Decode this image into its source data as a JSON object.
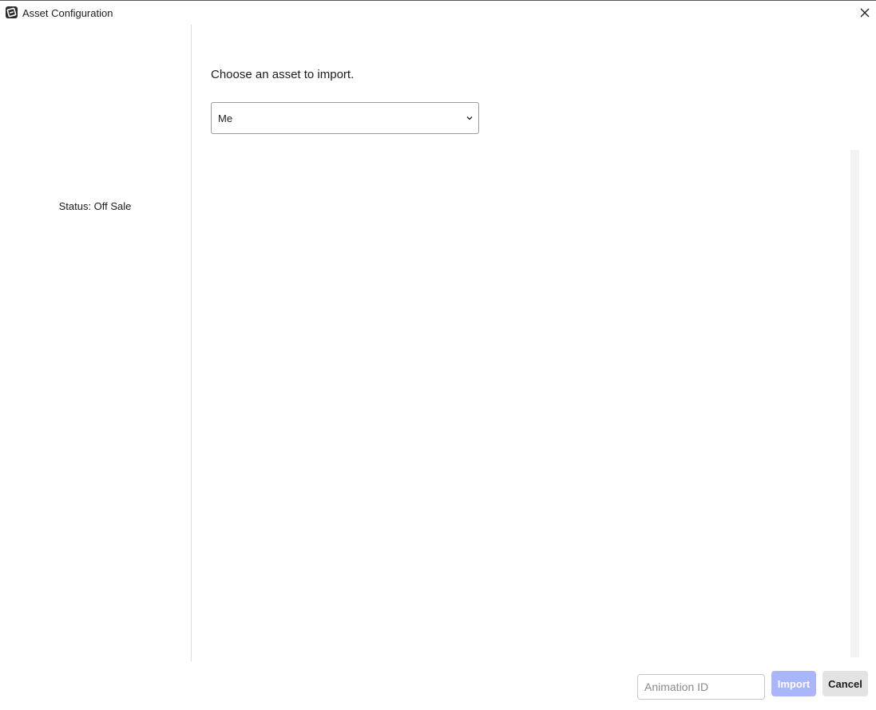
{
  "window": {
    "title": "Asset Configuration",
    "app_icon": "roblox-studio-icon",
    "close_icon": "close-icon"
  },
  "sidebar": {
    "status_text": "Status: Off Sale"
  },
  "main": {
    "prompt": "Choose an asset to import.",
    "owner_select": {
      "value": "Me",
      "icon": "chevron-down-icon"
    },
    "asset_list": []
  },
  "footer": {
    "animation_id_placeholder": "Animation ID",
    "animation_id_value": "",
    "import_label": "Import",
    "import_enabled": false,
    "cancel_label": "Cancel"
  },
  "colors": {
    "import_disabled_bg": "#a9b6fb",
    "cancel_bg": "#e3e3e3",
    "divider": "#dcdcdc",
    "scroll_track": "#f2f2f2"
  }
}
